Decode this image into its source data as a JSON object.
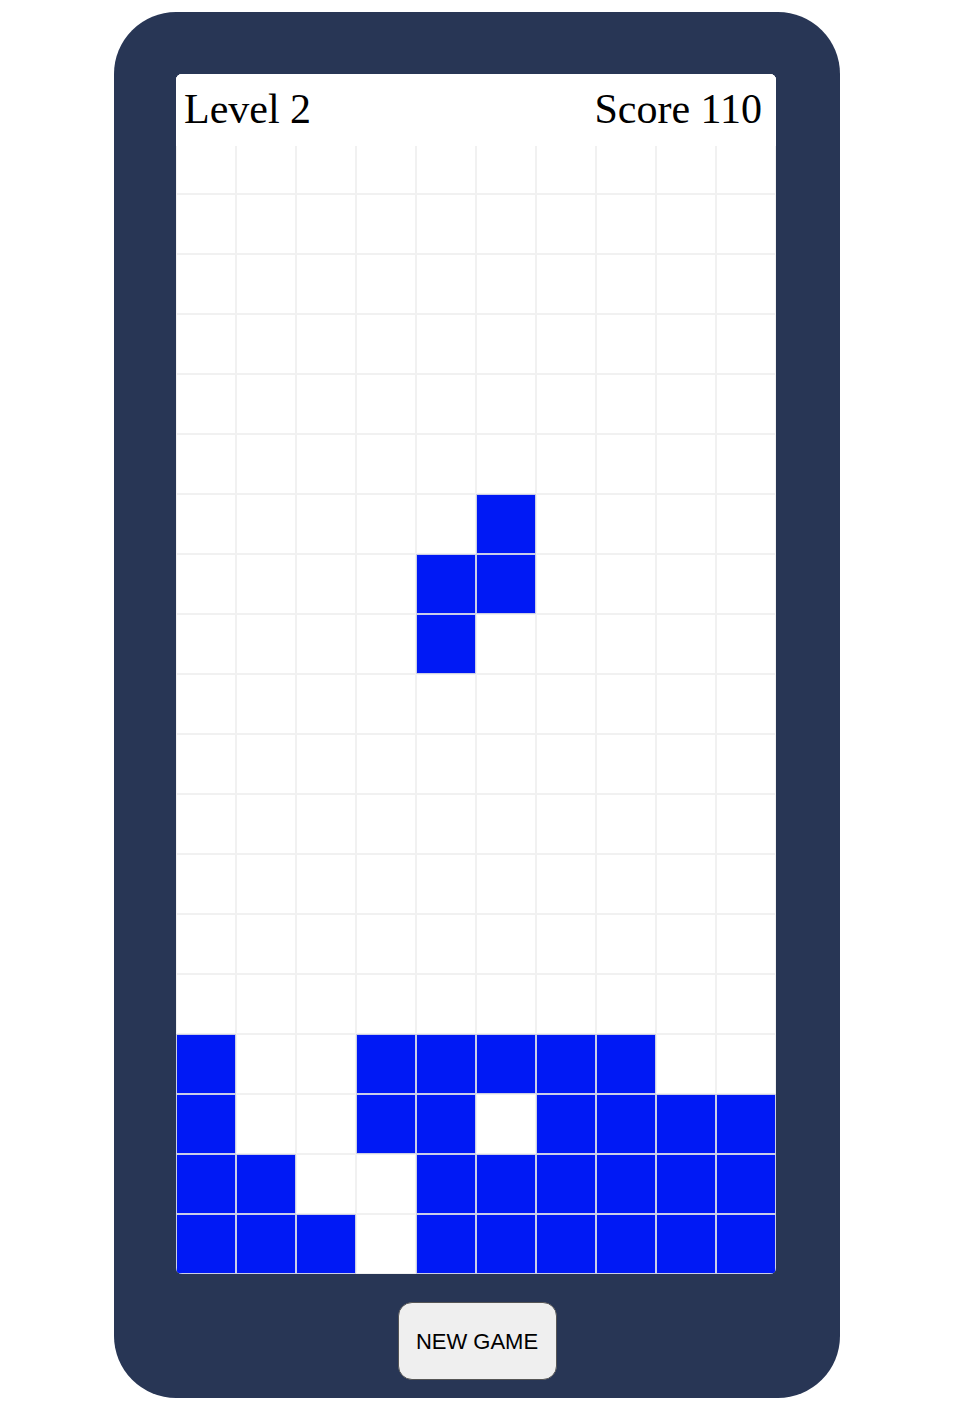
{
  "header": {
    "level": "Level 2",
    "score": "Score 110"
  },
  "board": {
    "rows": [
      [
        false,
        false,
        false,
        false,
        false,
        false,
        false,
        false,
        false,
        false
      ],
      [
        false,
        false,
        false,
        false,
        false,
        false,
        false,
        false,
        false,
        false
      ],
      [
        false,
        false,
        false,
        false,
        false,
        false,
        false,
        false,
        false,
        false
      ],
      [
        false,
        false,
        false,
        false,
        false,
        false,
        false,
        false,
        false,
        false
      ],
      [
        false,
        false,
        false,
        false,
        false,
        false,
        false,
        false,
        false,
        false
      ],
      [
        false,
        false,
        false,
        false,
        false,
        false,
        false,
        false,
        false,
        false
      ],
      [
        false,
        false,
        false,
        false,
        false,
        false,
        false,
        false,
        false,
        false
      ],
      [
        false,
        false,
        false,
        false,
        false,
        true,
        false,
        false,
        false,
        false
      ],
      [
        false,
        false,
        false,
        false,
        true,
        true,
        false,
        false,
        false,
        false
      ],
      [
        false,
        false,
        false,
        false,
        true,
        false,
        false,
        false,
        false,
        false
      ],
      [
        false,
        false,
        false,
        false,
        false,
        false,
        false,
        false,
        false,
        false
      ],
      [
        false,
        false,
        false,
        false,
        false,
        false,
        false,
        false,
        false,
        false
      ],
      [
        false,
        false,
        false,
        false,
        false,
        false,
        false,
        false,
        false,
        false
      ],
      [
        false,
        false,
        false,
        false,
        false,
        false,
        false,
        false,
        false,
        false
      ],
      [
        false,
        false,
        false,
        false,
        false,
        false,
        false,
        false,
        false,
        false
      ],
      [
        false,
        false,
        false,
        false,
        false,
        false,
        false,
        false,
        false,
        false
      ],
      [
        true,
        false,
        false,
        true,
        true,
        true,
        true,
        true,
        false,
        false
      ],
      [
        true,
        false,
        false,
        true,
        true,
        false,
        true,
        true,
        true,
        true
      ],
      [
        true,
        true,
        false,
        false,
        true,
        true,
        true,
        true,
        true,
        true
      ],
      [
        true,
        true,
        true,
        false,
        true,
        true,
        true,
        true,
        true,
        true
      ]
    ]
  },
  "buttons": [
    "NEW GAME"
  ]
}
